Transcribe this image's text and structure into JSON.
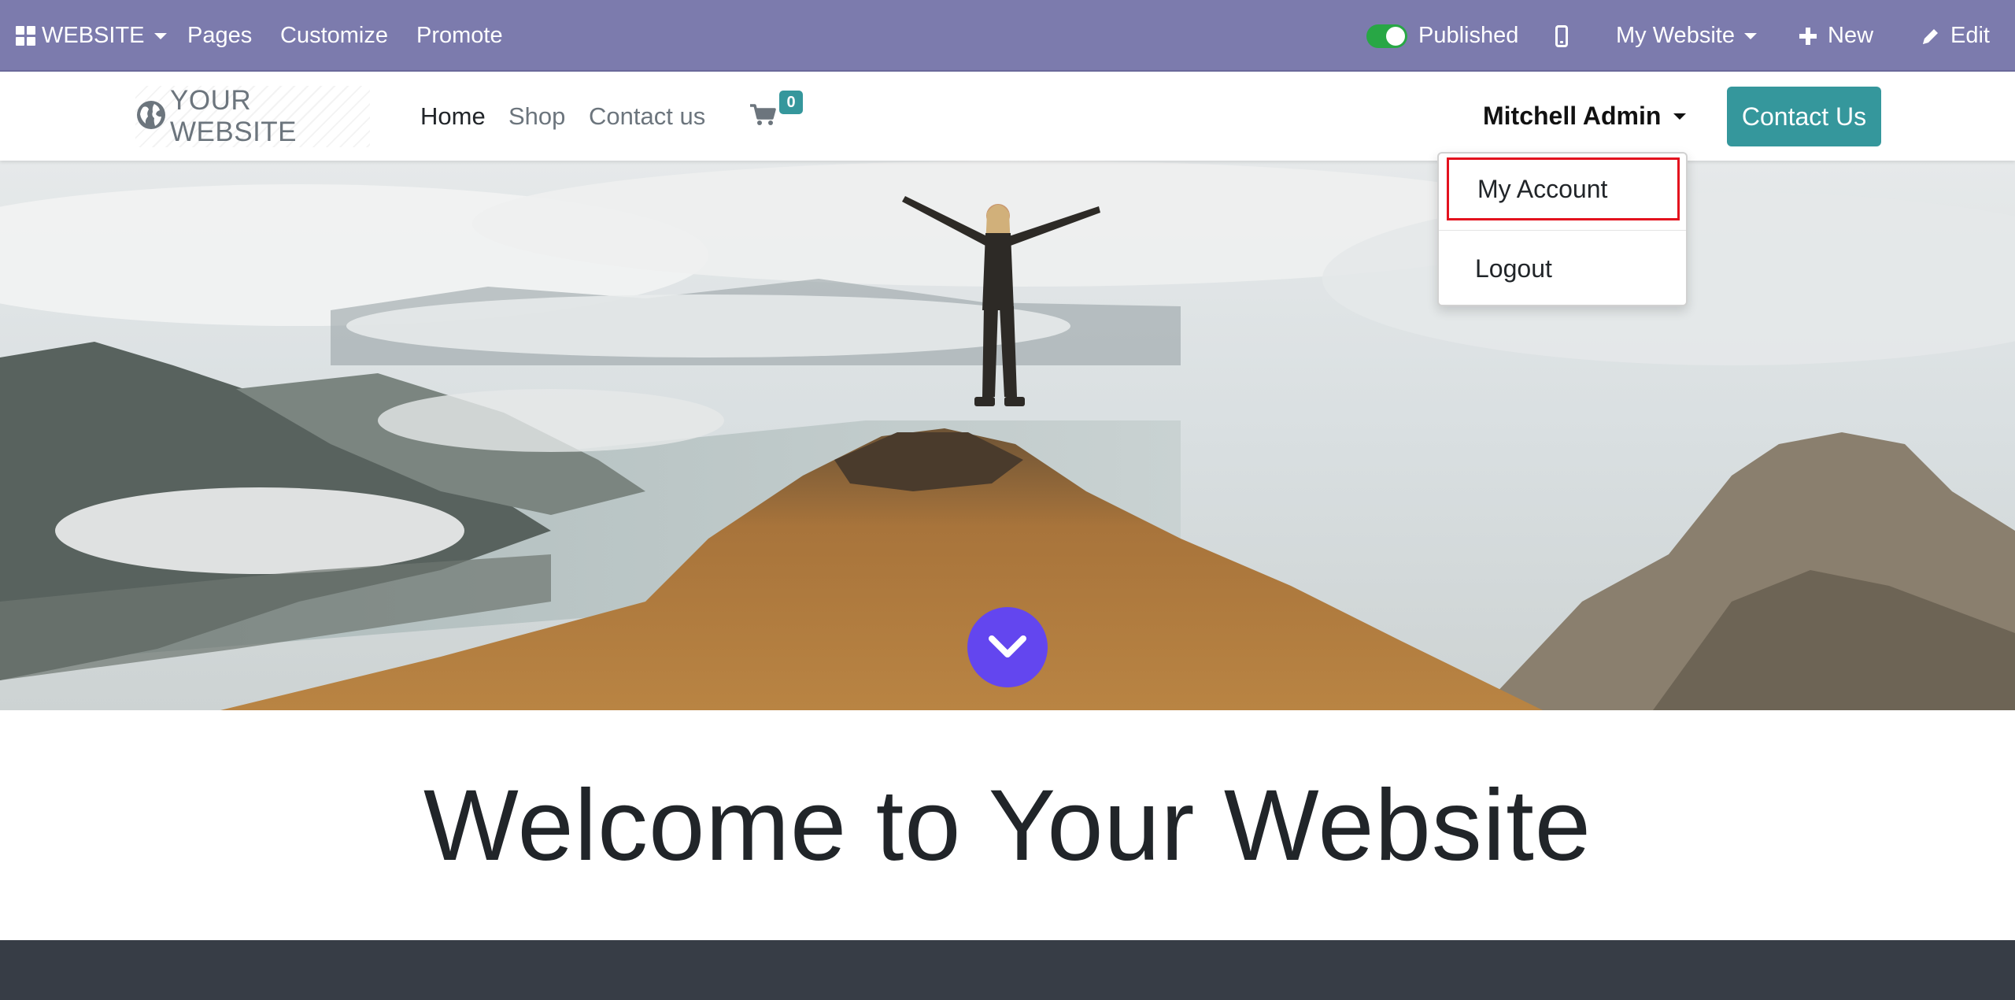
{
  "adminbar": {
    "app_label": "WEBSITE",
    "pages_label": "Pages",
    "customize_label": "Customize",
    "promote_label": "Promote",
    "published_label": "Published",
    "website_selector_label": "My Website",
    "new_label": "New",
    "edit_label": "Edit",
    "published_state": true,
    "bar_color": "#7c7bad",
    "toggle_color": "#28a745"
  },
  "header": {
    "logo_text": "YOUR WEBSITE",
    "nav": [
      {
        "label": "Home",
        "active": true
      },
      {
        "label": "Shop",
        "active": false
      },
      {
        "label": "Contact us",
        "active": false
      }
    ],
    "cart_count": "0",
    "user_name": "Mitchell Admin",
    "cta_label": "Contact Us",
    "accent_color": "#35979c"
  },
  "user_menu": {
    "items": [
      {
        "label": "My Account",
        "highlighted": true
      },
      {
        "label": "Logout",
        "highlighted": false
      }
    ],
    "highlight_color": "#e3121e"
  },
  "hero": {
    "scroll_button_color": "#6346ef",
    "scroll_icon": "chevron-down-icon"
  },
  "welcome": {
    "title": "Welcome to Your Website"
  }
}
